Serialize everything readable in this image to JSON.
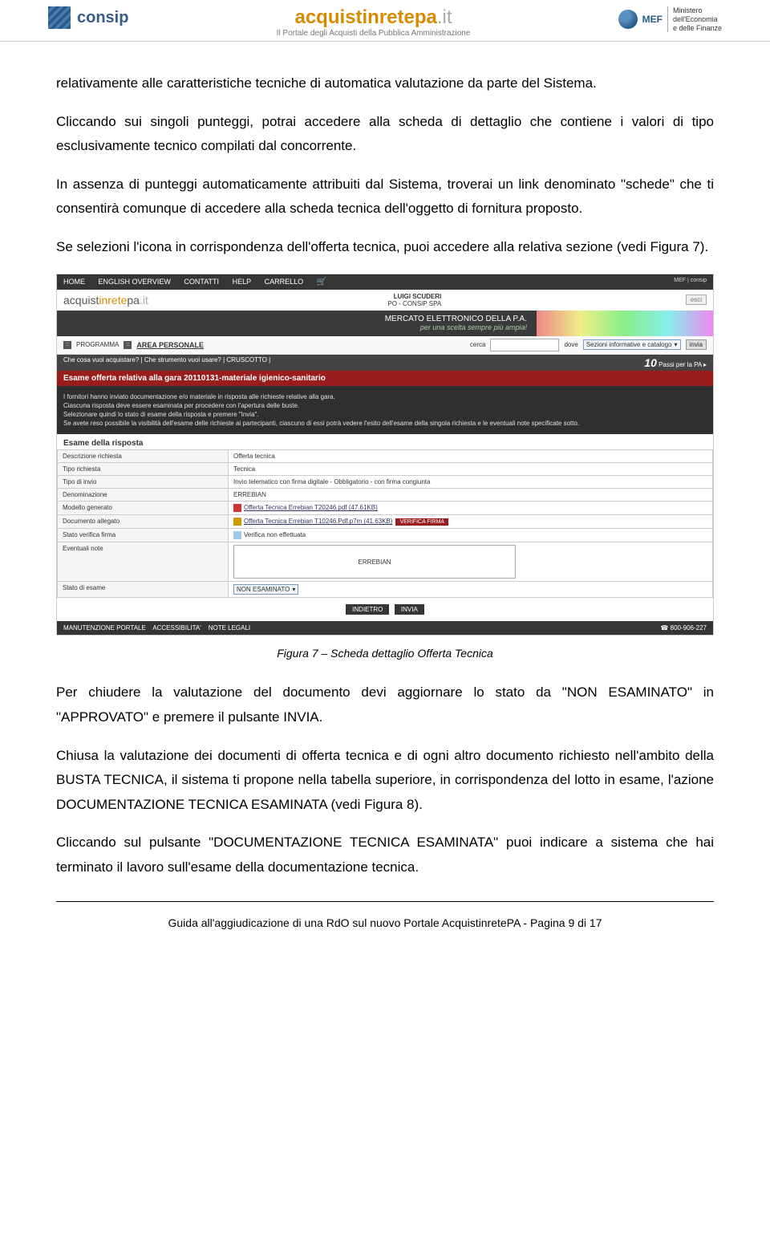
{
  "header": {
    "logo_left": "consip",
    "logo_center_main": "acquistinretepa",
    "logo_center_tld": ".it",
    "logo_center_sub": "Il Portale degli Acquisti della Pubblica Amministrazione",
    "logo_right_code": "MEF",
    "logo_right_line1": "Ministero",
    "logo_right_line2": "dell'Economia",
    "logo_right_line3": "e delle Finanze"
  },
  "body": {
    "p1": "relativamente alle caratteristiche tecniche di automatica valutazione da parte del Sistema.",
    "p2": "Cliccando sui singoli punteggi, potrai accedere alla scheda di dettaglio che contiene i valori di tipo esclusivamente tecnico compilati dal concorrente.",
    "p3": "In assenza di punteggi automaticamente attribuiti dal Sistema, troverai un link denominato \"schede\" che ti consentirà comunque di accedere alla scheda tecnica dell'oggetto di fornitura proposto.",
    "p4": "Se selezioni l'icona in corrispondenza dell'offerta tecnica, puoi accedere alla relativa sezione (vedi Figura 7).",
    "p5": "Per chiudere la valutazione del documento devi aggiornare lo stato da \"NON ESAMINATO\" in \"APPROVATO\" e premere il pulsante INVIA.",
    "p6": "Chiusa la valutazione dei documenti di offerta tecnica e di ogni altro documento richiesto nell'ambito della BUSTA TECNICA, il sistema ti propone nella tabella superiore, in corrispondenza del lotto in esame, l'azione DOCUMENTAZIONE TECNICA ESAMINATA (vedi Figura 8).",
    "p7": "Cliccando sul pulsante \"DOCUMENTAZIONE TECNICA ESAMINATA\" puoi indicare a sistema che hai terminato il lavoro sull'esame della documentazione tecnica."
  },
  "caption": "Figura 7 – Scheda dettaglio Offerta Tecnica",
  "embedded": {
    "top_nav": [
      "HOME",
      "ENGLISH OVERVIEW",
      "CONTATTI",
      "HELP",
      "CARRELLO"
    ],
    "user_name": "LUIGI SCUDERI",
    "user_org": "PO - CONSIP SPA",
    "esci": "esci",
    "mercato_line1": "MERCATO ELETTRONICO DELLA P.A.",
    "mercato_line2": "per una scelta sempre più ampia!",
    "nav2_prog": "PROGRAMMA",
    "nav2_area": "AREA PERSONALE",
    "nav2_cerca": "cerca",
    "nav2_dove": "dove",
    "nav2_dove_val": "Sezioni informative e catalogo",
    "nav2_invia": "invia",
    "passi_left": [
      "Che cosa vuoi acquistare?",
      "Che strumento vuoi usare?",
      "CRUSCOTTO"
    ],
    "passi_right": "Passi per la PA",
    "title": "Esame offerta relativa alla gara 20110131-materiale igienico-sanitario",
    "info_l1": "I fornitori hanno inviato documentazione e/o materiale in risposta alle richieste relative alla gara.",
    "info_l2": "Ciascuna risposta deve essere esaminata per procedere con l'apertura delle buste.",
    "info_l3": "Selezionare quindi lo stato di esame della risposta e premere \"Invia\".",
    "info_l4": "Se avete reso possibile la visibilità dell'esame delle richieste ai partecipanti, ciascuno di essi potrà vedere l'esito dell'esame della singola richiesta e le eventuali note specificate sotto.",
    "subtitle": "Esame della risposta",
    "rows": {
      "desc_l": "Descrizione richiesta",
      "desc_v": "Offerta tecnica",
      "tipo_l": "Tipo richiesta",
      "tipo_v": "Tecnica",
      "invio_l": "Tipo di invio",
      "invio_v": "Invio telematico con firma digitale - Obbligatorio - con firma congiunta",
      "denom_l": "Denominazione",
      "denom_v": "ERREBIAN",
      "model_l": "Modello generato",
      "model_v": "Offerta Tecnica Errebian T20246.pdf (47.61KB)",
      "doc_l": "Documento allegato",
      "doc_v": "Offerta Tecnica Errebian T10246.Pdf.p7m (41.63KB)",
      "doc_btn": "VERIFICA FIRMA",
      "firma_l": "Stato verifica firma",
      "firma_v": "Verifica non effettuata",
      "note_l": "Eventuali note",
      "note_v": "ERREBIAN",
      "stato_l": "Stato di esame",
      "stato_v": "NON ESAMINATO"
    },
    "actions": {
      "indietro": "INDIETRO",
      "invia": "INVIA"
    },
    "footer_left": [
      "MANUTENZIONE PORTALE",
      "ACCESSIBILITA'",
      "NOTE LEGALI"
    ],
    "footer_phone": "800-906-227"
  },
  "footer": {
    "text": "Guida all'aggiudicazione di una RdO sul nuovo Portale AcquistinretePA    -    Pagina 9 di 17"
  }
}
